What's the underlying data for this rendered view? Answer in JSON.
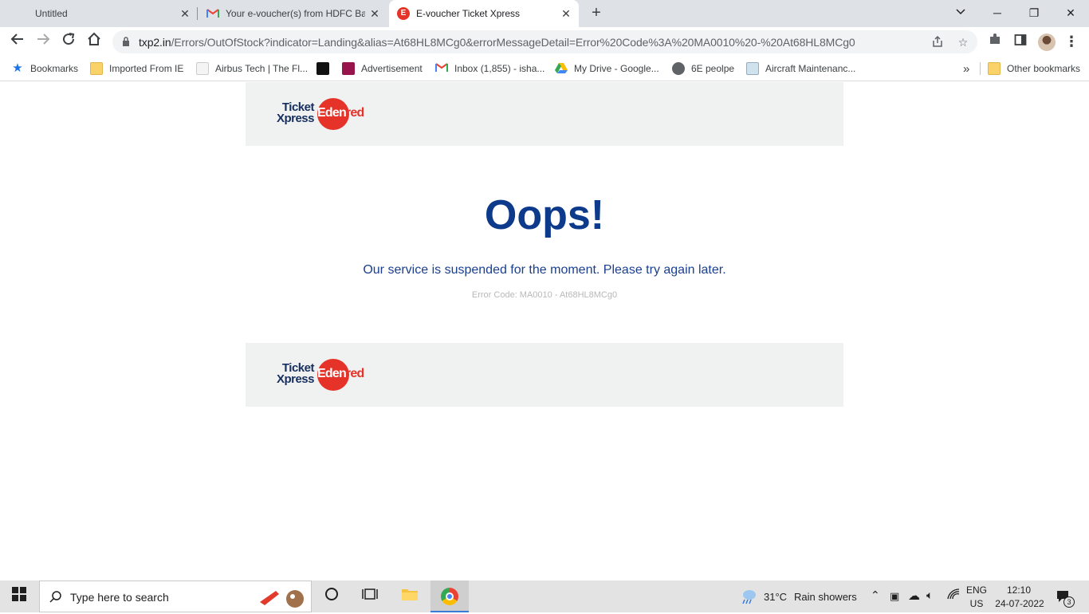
{
  "browser": {
    "tabs": [
      {
        "title": "Untitled",
        "icon": "blank",
        "active": false
      },
      {
        "title": "Your e-voucher(s) from HDFC Ba",
        "icon": "gmail-icon",
        "active": false
      },
      {
        "title": "E-voucher Ticket Xpress",
        "icon": "edenred-icon",
        "active": true
      }
    ],
    "url_host": "txp2.in",
    "url_path": "/Errors/OutOfStock?indicator=Landing&alias=At68HL8MCg0&errorMessageDetail=Error%20Code%3A%20MA0010%20-%20At68HL8MCg0",
    "bookmarks": [
      {
        "label": "Bookmarks",
        "icon": "star"
      },
      {
        "label": "Imported From IE",
        "icon": "folder"
      },
      {
        "label": "Airbus Tech | The Fl...",
        "icon": "airbus"
      },
      {
        "label": "",
        "icon": "dark-site"
      },
      {
        "label": "Advertisement",
        "icon": "axis"
      },
      {
        "label": "Inbox (1,855) - isha...",
        "icon": "gmail"
      },
      {
        "label": "My Drive - Google...",
        "icon": "drive"
      },
      {
        "label": "6E peolpe",
        "icon": "globe"
      },
      {
        "label": "Aircraft Maintenanc...",
        "icon": "site"
      }
    ],
    "overflow_label": "»",
    "other_bookmarks": "Other bookmarks"
  },
  "page": {
    "logo_ticket": "Ticket",
    "logo_xpress": "Xpress",
    "logo_edenred": "Edenred",
    "heading": "Oops!",
    "message": "Our service is suspended for the moment. Please try again later.",
    "error_code": "Error Code: MA0010 - At68HL8MCg0"
  },
  "taskbar": {
    "search_placeholder": "Type here to search",
    "weather_temp": "31°C",
    "weather_desc": "Rain showers",
    "lang_top": "ENG",
    "lang_bottom": "US",
    "time": "12:10",
    "date": "24-07-2022",
    "notification_count": "3"
  },
  "colors": {
    "brand_blue": "#0e3a8c",
    "brand_red": "#e5332a",
    "band_gray": "#f0f1f1"
  }
}
